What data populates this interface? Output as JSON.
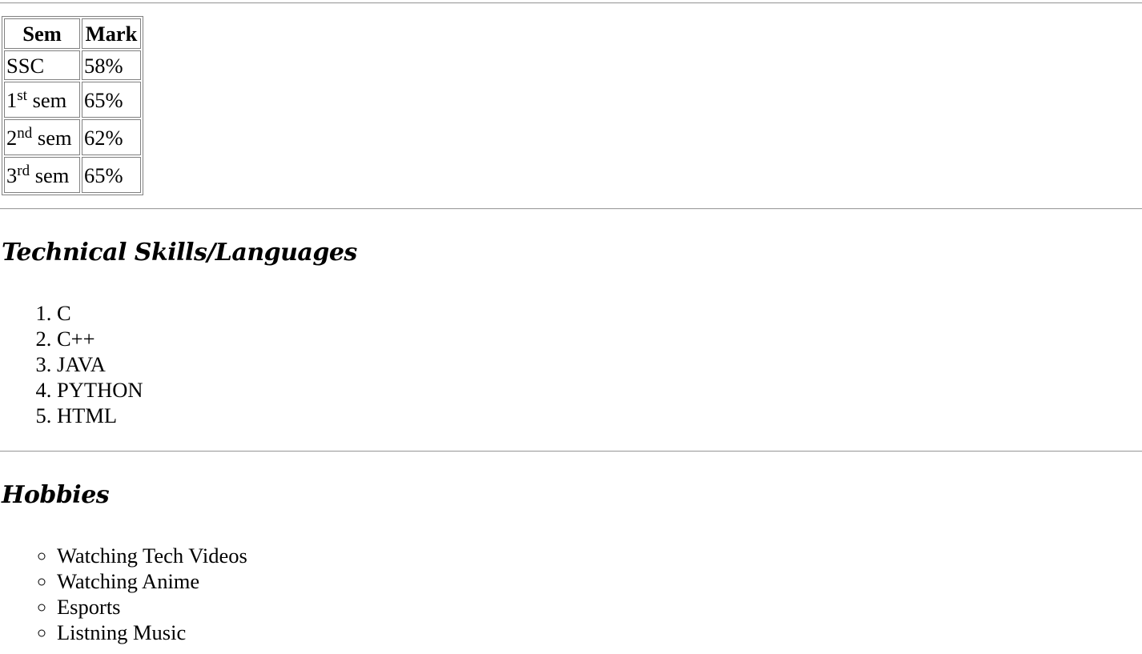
{
  "marks_table": {
    "headers": [
      "Sem",
      "Mark"
    ],
    "rows": [
      {
        "sem": "SSC",
        "sem_sup": "",
        "sem_suffix": "",
        "mark": "58%"
      },
      {
        "sem": "1",
        "sem_sup": "st",
        "sem_suffix": " sem",
        "mark": "65%"
      },
      {
        "sem": "2",
        "sem_sup": "nd",
        "sem_suffix": " sem",
        "mark": "62%"
      },
      {
        "sem": "3",
        "sem_sup": "rd",
        "sem_suffix": " sem",
        "mark": "65%"
      }
    ]
  },
  "skills": {
    "title": "Technical Skills/Languages",
    "items": [
      "C",
      "C++",
      "JAVA",
      "PYTHON",
      "HTML"
    ]
  },
  "hobbies": {
    "title": "Hobbies",
    "items": [
      "Watching Tech Videos",
      "Watching Anime",
      "Esports",
      "Listning Music"
    ]
  }
}
